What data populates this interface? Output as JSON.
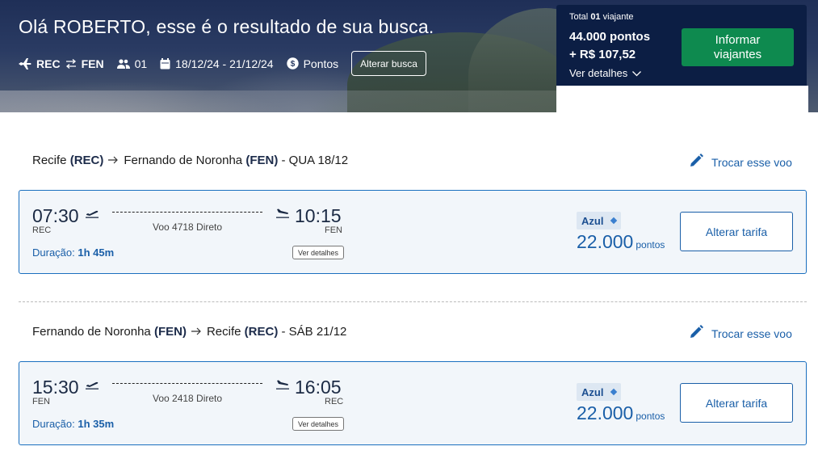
{
  "header": {
    "greeting": "Olá ROBERTO, esse é o resultado de sua busca.",
    "origin": "REC",
    "destination": "FEN",
    "passengers": "01",
    "dates": "18/12/24 - 21/12/24",
    "payment": "Pontos",
    "alter_search_label": "Alterar busca"
  },
  "summary": {
    "total_prefix": "Total",
    "total_count": "01",
    "total_suffix": "viajante",
    "points": "44.000 pontos",
    "cash": "+ R$ 107,52",
    "details_label": "Ver detalhes",
    "inform_label_1": "Informar",
    "inform_label_2": "viajantes"
  },
  "segments": [
    {
      "from_city": "Recife",
      "from_code": "(REC)",
      "to_city": "Fernando de Noronha",
      "to_code": "(FEN)",
      "date": "- QUA 18/12",
      "swap_label": "Trocar esse voo",
      "depart_time": "07:30",
      "depart_apt": "REC",
      "arrive_time": "10:15",
      "arrive_apt": "FEN",
      "flight": "Voo 4718 Direto",
      "duration_label": "Duração:",
      "duration": "1h 45m",
      "details_label": "Ver detalhes",
      "airline": "Azul",
      "price": "22.000",
      "price_unit": "pontos",
      "fare_label": "Alterar tarifa"
    },
    {
      "from_city": "Fernando de Noronha",
      "from_code": "(FEN)",
      "to_city": "Recife",
      "to_code": "(REC)",
      "date": "- SÁB 21/12",
      "swap_label": "Trocar esse voo",
      "depart_time": "15:30",
      "depart_apt": "FEN",
      "arrive_time": "16:05",
      "arrive_apt": "REC",
      "flight": "Voo 2418 Direto",
      "duration_label": "Duração:",
      "duration": "1h 35m",
      "details_label": "Ver detalhes",
      "airline": "Azul",
      "price": "22.000",
      "price_unit": "pontos",
      "fare_label": "Alterar tarifa"
    }
  ],
  "colors": {
    "accent": "#1a5fa8",
    "summary_bg": "#0c1e44",
    "cta_green": "#0e8a4f",
    "card_bg": "#f2f6fa"
  },
  "icons": [
    "plane-icon",
    "swap-arrows-icon",
    "people-icon",
    "calendar-icon",
    "coin-icon",
    "chevron-down-icon",
    "pencil-icon",
    "arrow-right-icon",
    "takeoff-icon",
    "landing-icon"
  ]
}
